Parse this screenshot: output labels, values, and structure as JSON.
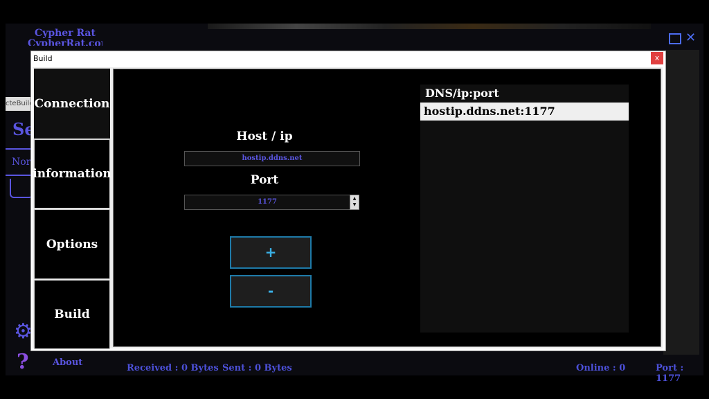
{
  "app": {
    "title": "Cypher Rat",
    "site": "CypherRat.com"
  },
  "background": {
    "input_text": "cteBuild",
    "heading_partial": "Se",
    "tab_partial": "Norr",
    "about": "About"
  },
  "status": {
    "received": "Received : 0 Bytes",
    "sent": "Sent : 0 Bytes",
    "online": "Online : 0",
    "port": "Port : 1177"
  },
  "dialog": {
    "title": "Build",
    "close": "x",
    "tabs": [
      "Connection",
      "information",
      "Options",
      "Build"
    ],
    "host_label": "Host / ip",
    "host_value": "hostip.ddns.net",
    "port_label": "Port",
    "port_value": "1177",
    "add_label": "+",
    "remove_label": "-",
    "list_header": "DNS/ip:port",
    "list_items": [
      "hostip.ddns.net:1177"
    ]
  },
  "icons": {
    "maximize": "maximize-icon",
    "close": "close-icon",
    "settings": "gear-icon",
    "help": "help-icon",
    "spin_up": "chevron-up-icon",
    "spin_down": "chevron-down-icon"
  },
  "colors": {
    "accent": "#5a55e0",
    "button_border": "#1e7aa8",
    "button_text": "#3ab0e6",
    "close_red": "#e04040"
  }
}
